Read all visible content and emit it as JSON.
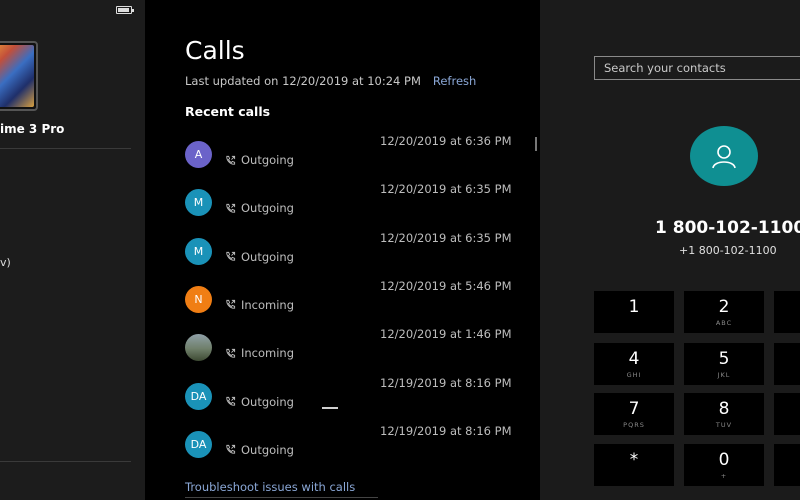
{
  "sidebar": {
    "device_name_fragment": "ime 3 Pro",
    "text_fragment": "v)"
  },
  "calls": {
    "title": "Calls",
    "last_updated": "Last updated on 12/20/2019 at 10:24 PM",
    "refresh_label": "Refresh",
    "recent_heading": "Recent calls",
    "items": [
      {
        "initials": "A",
        "color": "#6b63c9",
        "type": "Outgoing",
        "time": "12/20/2019 at 6:36 PM"
      },
      {
        "initials": "M",
        "color": "#1a92b8",
        "type": "Outgoing",
        "time": "12/20/2019 at 6:35 PM"
      },
      {
        "initials": "M",
        "color": "#1a92b8",
        "type": "Outgoing",
        "time": "12/20/2019 at 6:35 PM"
      },
      {
        "initials": "N",
        "color": "#f07e14",
        "type": "Incoming",
        "time": "12/20/2019 at 5:46 PM"
      },
      {
        "initials": "",
        "color": "photo",
        "type": "Incoming",
        "time": "12/20/2019 at 1:46 PM"
      },
      {
        "initials": "DA",
        "color": "#1a92b8",
        "type": "Outgoing",
        "time": "12/19/2019 at 8:16 PM"
      },
      {
        "initials": "DA",
        "color": "#1a92b8",
        "type": "Outgoing",
        "time": "12/19/2019 at 8:16 PM"
      }
    ],
    "troubleshoot_label": "Troubleshoot issues with calls"
  },
  "dialer": {
    "search_placeholder": "Search your contacts",
    "contact_icon": "person-icon",
    "number_main": "1 800-102-1100",
    "number_sub": "+1 800-102-1100",
    "keys": [
      {
        "digit": "1",
        "letters": ""
      },
      {
        "digit": "2",
        "letters": "ABC"
      },
      {
        "digit": "4",
        "letters": "GHI"
      },
      {
        "digit": "5",
        "letters": "JKL"
      },
      {
        "digit": "7",
        "letters": "PQRS"
      },
      {
        "digit": "8",
        "letters": "TUV"
      },
      {
        "digit": "*",
        "letters": ""
      },
      {
        "digit": "0",
        "letters": "+"
      }
    ]
  },
  "colors": {
    "accent_teal": "#0f8f92",
    "link_blue": "#8aa7d6"
  }
}
